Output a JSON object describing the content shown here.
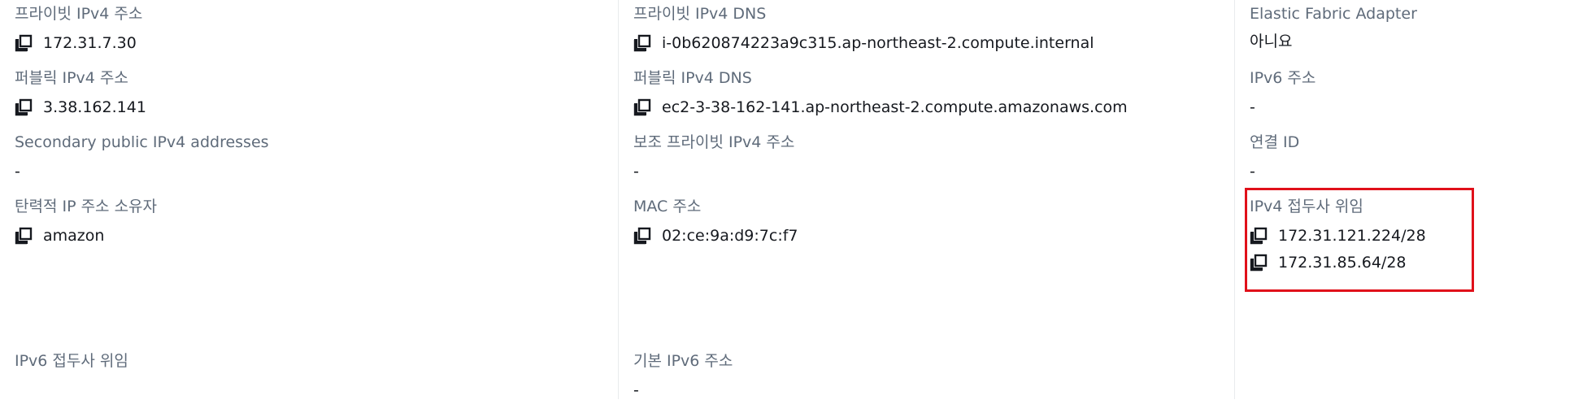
{
  "column1": {
    "private_ipv4": {
      "label": "프라이빗 IPv4 주소",
      "value": "172.31.7.30"
    },
    "public_ipv4": {
      "label": "퍼블릭 IPv4 주소",
      "value": "3.38.162.141"
    },
    "secondary_public_ipv4": {
      "label": "Secondary public IPv4 addresses",
      "value": "-"
    },
    "elastic_ip_owner": {
      "label": "탄력적 IP 주소 소유자",
      "value": "amazon"
    },
    "ipv6_prefix_delegation": {
      "label": "IPv6 접두사 위임"
    }
  },
  "column2": {
    "private_ipv4_dns": {
      "label": "프라이빗 IPv4 DNS",
      "value": "i-0b620874223a9c315.ap-northeast-2.compute.internal"
    },
    "public_ipv4_dns": {
      "label": "퍼블릭 IPv4 DNS",
      "value": "ec2-3-38-162-141.ap-northeast-2.compute.amazonaws.com"
    },
    "secondary_private_ipv4": {
      "label": "보조 프라이빗 IPv4 주소",
      "value": "-"
    },
    "mac_address": {
      "label": "MAC 주소",
      "value": "02:ce:9a:d9:7c:f7"
    },
    "primary_ipv6": {
      "label": "기본 IPv6 주소",
      "value": "-"
    }
  },
  "column3": {
    "efa": {
      "label": "Elastic Fabric Adapter",
      "value": "아니요"
    },
    "ipv6_address": {
      "label": "IPv6 주소",
      "value": "-"
    },
    "association_id": {
      "label": "연결 ID",
      "value": "-"
    },
    "ipv4_prefix_delegation": {
      "label": "IPv4 접두사 위임",
      "values": [
        "172.31.121.224/28",
        "172.31.85.64/28"
      ]
    }
  },
  "icons": {
    "copy": "copy-icon"
  },
  "colors": {
    "label": "#5f6b7a",
    "value": "#16191f",
    "highlight_border": "#e0101a",
    "divider": "#e9ebed"
  }
}
